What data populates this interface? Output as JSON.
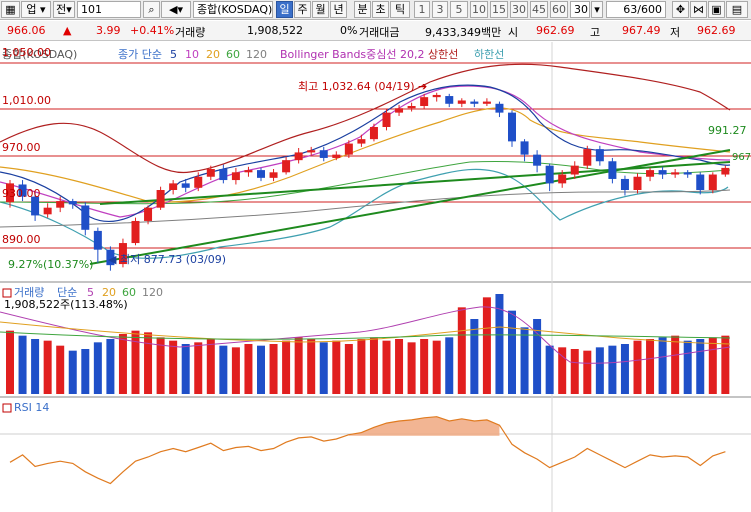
{
  "toolbar": {
    "scope_label": "업",
    "type_label": "전",
    "code_value": "101",
    "search_icon": "search-icon",
    "sound_icon": "speaker-icon",
    "market_name": "종합(KOSDAQ)",
    "periods": [
      "일",
      "주",
      "월",
      "년",
      "분",
      "초",
      "틱"
    ],
    "selected_period": "일",
    "intervals": [
      "1",
      "3",
      "5",
      "10",
      "15",
      "30",
      "45",
      "60"
    ],
    "interval_value": "30",
    "page_counter": "63/600"
  },
  "quote": {
    "price": "966.06",
    "change_arrow": "▲",
    "change": "3.99",
    "change_pct": "+0.41%",
    "volume_label": "거래량",
    "volume_value": "1,908,522",
    "ratio": "0%",
    "amount_label": "거래대금",
    "amount_value": "9,433,349백만",
    "open_label": "시",
    "open_value": "962.69",
    "high_label": "고",
    "high_value": "967.49",
    "low_label": "저",
    "low_value": "962.69"
  },
  "price_panel": {
    "legend": {
      "series_name": "종합(KOSDAQ)",
      "ma_label": "종가 단순",
      "ma_periods": [
        "5",
        "10",
        "20",
        "60",
        "120"
      ],
      "bollinger_label": "Bollinger Bands중심선 20,2",
      "upper_label": "상한선",
      "lower_label": "하한선"
    },
    "y_labels": [
      "1,050.00",
      "1,010.00",
      "970.00",
      "930.00",
      "890.00"
    ],
    "annotations": {
      "high": "최고 1,032.64 (04/19)",
      "low": "최저 877.73 (03/09)",
      "trend_top": "991.27",
      "trend_pct": "9.27%(10.37%)",
      "current": "967"
    }
  },
  "volume_panel": {
    "title": "거래량",
    "ma_label": "단순",
    "ma_periods": [
      "5",
      "20",
      "60",
      "120"
    ],
    "current": "1,908,522주(113.48%)"
  },
  "rsi_panel": {
    "title": "RSI 14"
  },
  "chart_data": {
    "type": "candlestick",
    "y_range": [
      870,
      1060
    ],
    "high_marker": 1032.64,
    "low_marker": 877.73,
    "candles": [
      [
        935,
        952,
        930,
        955
      ],
      [
        951,
        940,
        936,
        955
      ],
      [
        940,
        923,
        918,
        944
      ],
      [
        924,
        930,
        921,
        934
      ],
      [
        930,
        936,
        926,
        940
      ],
      [
        936,
        933,
        929,
        938
      ],
      [
        932,
        910,
        905,
        935
      ],
      [
        909,
        892,
        880,
        912
      ],
      [
        892,
        878,
        873,
        895
      ],
      [
        879,
        898,
        876,
        902
      ],
      [
        898,
        918,
        896,
        921
      ],
      [
        918,
        930,
        915,
        932
      ],
      [
        930,
        946,
        928,
        949
      ],
      [
        946,
        952,
        942,
        955
      ],
      [
        952,
        948,
        944,
        956
      ],
      [
        948,
        958,
        945,
        962
      ],
      [
        958,
        965,
        955,
        968
      ],
      [
        965,
        955,
        952,
        969
      ],
      [
        955,
        962,
        951,
        966
      ],
      [
        962,
        964,
        958,
        967
      ],
      [
        964,
        957,
        954,
        966
      ],
      [
        957,
        962,
        954,
        965
      ],
      [
        962,
        973,
        960,
        976
      ],
      [
        973,
        980,
        970,
        984
      ],
      [
        980,
        982,
        977,
        985
      ],
      [
        982,
        975,
        972,
        985
      ],
      [
        975,
        978,
        973,
        981
      ],
      [
        978,
        988,
        975,
        991
      ],
      [
        988,
        992,
        985,
        996
      ],
      [
        992,
        1003,
        990,
        1006
      ],
      [
        1003,
        1016,
        1000,
        1019
      ],
      [
        1016,
        1020,
        1013,
        1023
      ],
      [
        1020,
        1022,
        1017,
        1025
      ],
      [
        1022,
        1030,
        1019,
        1033
      ],
      [
        1030,
        1032,
        1026,
        1034
      ],
      [
        1031,
        1024,
        1021,
        1033
      ],
      [
        1024,
        1027,
        1021,
        1029
      ],
      [
        1026,
        1024,
        1021,
        1028
      ],
      [
        1024,
        1026,
        1022,
        1029
      ],
      [
        1024,
        1016,
        1012,
        1026
      ],
      [
        1016,
        990,
        985,
        1018
      ],
      [
        990,
        978,
        972,
        992
      ],
      [
        978,
        968,
        962,
        982
      ],
      [
        968,
        952,
        945,
        970
      ],
      [
        952,
        960,
        948,
        964
      ],
      [
        960,
        968,
        956,
        972
      ],
      [
        968,
        983,
        965,
        986
      ],
      [
        983,
        972,
        968,
        986
      ],
      [
        972,
        956,
        952,
        975
      ],
      [
        956,
        946,
        941,
        959
      ],
      [
        946,
        958,
        943,
        961
      ],
      [
        958,
        964,
        954,
        966
      ],
      [
        964,
        960,
        956,
        967
      ],
      [
        960,
        962,
        957,
        965
      ],
      [
        962,
        960,
        957,
        964
      ],
      [
        960,
        946,
        942,
        962
      ],
      [
        946,
        960,
        943,
        962
      ],
      [
        960,
        966,
        958,
        968
      ]
    ],
    "volume": [
      190,
      175,
      165,
      160,
      145,
      130,
      135,
      155,
      165,
      180,
      190,
      185,
      170,
      160,
      150,
      155,
      165,
      145,
      140,
      150,
      145,
      150,
      160,
      170,
      165,
      155,
      160,
      150,
      165,
      170,
      160,
      165,
      155,
      165,
      160,
      170,
      260,
      225,
      290,
      300,
      250,
      200,
      225,
      145,
      140,
      135,
      130,
      140,
      145,
      150,
      160,
      165,
      170,
      175,
      160,
      165,
      170,
      175
    ],
    "volume_max": 300,
    "rsi": [
      45,
      52,
      41,
      44,
      46,
      44,
      36,
      30,
      25,
      36,
      46,
      50,
      55,
      58,
      55,
      59,
      63,
      56,
      59,
      60,
      56,
      58,
      64,
      68,
      69,
      65,
      67,
      71,
      73,
      78,
      82,
      84,
      85,
      87,
      88,
      84,
      86,
      84,
      85,
      80,
      62,
      54,
      48,
      40,
      45,
      50,
      58,
      52,
      46,
      40,
      46,
      52,
      50,
      51,
      50,
      42,
      51,
      55
    ]
  }
}
